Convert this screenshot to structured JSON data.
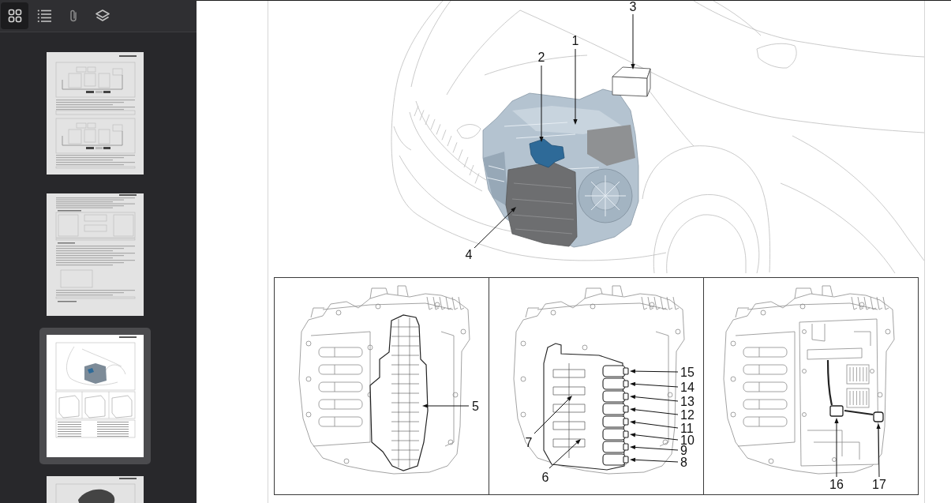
{
  "sidebar": {
    "tools": [
      {
        "kind": "grid",
        "selected": true
      },
      {
        "kind": "list",
        "selected": false
      },
      {
        "kind": "attachment",
        "selected": false
      },
      {
        "kind": "layers",
        "selected": false
      }
    ],
    "thumbnails": [
      {
        "kind": "diagram",
        "selected": false
      },
      {
        "kind": "text",
        "selected": false
      },
      {
        "kind": "figure",
        "selected": true
      },
      {
        "kind": "photo",
        "selected": false
      }
    ]
  },
  "page": {
    "overview": {
      "callouts": [
        {
          "label": "3"
        },
        {
          "label": "1"
        },
        {
          "label": "2"
        },
        {
          "label": "4"
        }
      ]
    },
    "panels": [
      {
        "kind": "cover",
        "callouts": [
          {
            "label": "5"
          }
        ]
      },
      {
        "kind": "solenoids",
        "callouts": [
          {
            "label": "15"
          },
          {
            "label": "14"
          },
          {
            "label": "13"
          },
          {
            "label": "12"
          },
          {
            "label": "11"
          },
          {
            "label": "10"
          },
          {
            "label": "9"
          },
          {
            "label": "8"
          },
          {
            "label": "7"
          },
          {
            "label": "6"
          }
        ]
      },
      {
        "kind": "harness",
        "callouts": [
          {
            "label": "16"
          },
          {
            "label": "17"
          }
        ]
      }
    ]
  }
}
